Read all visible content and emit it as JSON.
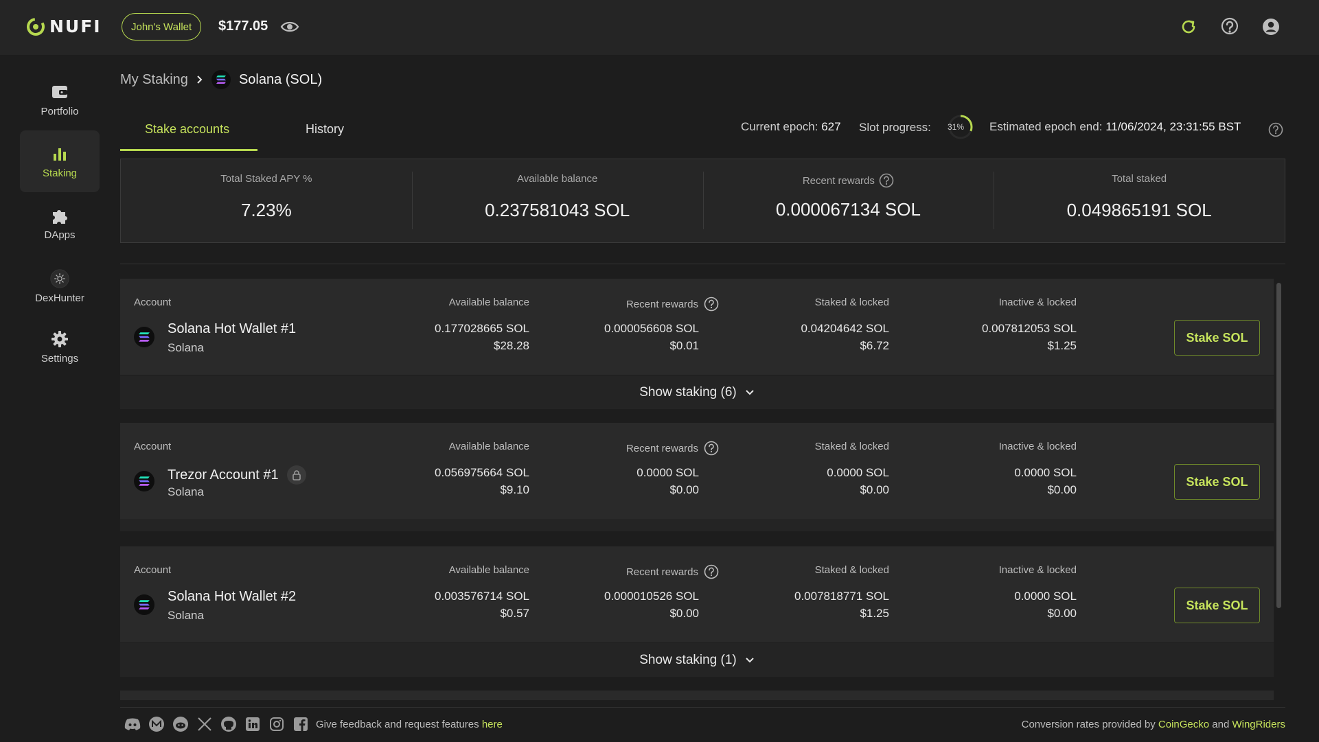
{
  "app": {
    "brand": "NUFI"
  },
  "header": {
    "wallet_name": "John's Wallet",
    "balance": "$177.05"
  },
  "sidebar": {
    "items": [
      {
        "label": "Portfolio",
        "icon": "wallet-icon"
      },
      {
        "label": "Staking",
        "icon": "bar-chart-icon",
        "active": true
      },
      {
        "label": "DApps",
        "icon": "puzzle-icon"
      },
      {
        "label": "DexHunter",
        "icon": "dexhunter-icon"
      },
      {
        "label": "Settings",
        "icon": "gear-icon"
      }
    ]
  },
  "breadcrumb": {
    "parent": "My Staking",
    "current": "Solana (SOL)"
  },
  "tabs": [
    {
      "label": "Stake accounts",
      "active": true
    },
    {
      "label": "History"
    }
  ],
  "epoch": {
    "current_label": "Current epoch:",
    "current_value": "627",
    "slot_label": "Slot progress:",
    "slot_value": "31%",
    "slot_fraction": 0.31,
    "end_label": "Estimated epoch end:",
    "end_value": "11/06/2024, 23:31:55 BST"
  },
  "summary": [
    {
      "label": "Total Staked APY %",
      "value": "7.23%"
    },
    {
      "label": "Available balance",
      "value": "0.237581043 SOL"
    },
    {
      "label": "Recent rewards",
      "value": "0.000067134 SOL"
    },
    {
      "label": "Total staked",
      "value": "0.049865191 SOL"
    }
  ],
  "columns": {
    "account": "Account",
    "available": "Available balance",
    "rewards": "Recent rewards",
    "staked": "Staked & locked",
    "inactive": "Inactive & locked"
  },
  "accounts": [
    {
      "name": "Solana Hot Wallet #1",
      "chain": "Solana",
      "available": "0.177028665 SOL",
      "available_usd": "$28.28",
      "rewards": "0.000056608 SOL",
      "rewards_usd": "$0.01",
      "staked": "0.04204642 SOL",
      "staked_usd": "$6.72",
      "inactive": "0.007812053 SOL",
      "inactive_usd": "$1.25",
      "button": "Stake SOL",
      "show_staking": "Show staking (6)"
    },
    {
      "name": "Trezor Account #1",
      "chain": "Solana",
      "available": "0.056975664 SOL",
      "available_usd": "$9.10",
      "rewards": "0.0000 SOL",
      "rewards_usd": "$0.00",
      "staked": "0.0000 SOL",
      "staked_usd": "$0.00",
      "inactive": "0.0000 SOL",
      "inactive_usd": "$0.00",
      "button": "Stake SOL"
    },
    {
      "name": "Solana Hot Wallet #2",
      "chain": "Solana",
      "available": "0.003576714 SOL",
      "available_usd": "$0.57",
      "rewards": "0.000010526 SOL",
      "rewards_usd": "$0.00",
      "staked": "0.007818771 SOL",
      "staked_usd": "$1.25",
      "inactive": "0.0000 SOL",
      "inactive_usd": "$0.00",
      "button": "Stake SOL",
      "show_staking": "Show staking (1)"
    }
  ],
  "footer": {
    "feedback": "Give feedback and request features",
    "feedback_link": "here",
    "rates_prefix": "Conversion rates provided by",
    "rates_source_1": "CoinGecko",
    "rates_and": "and",
    "rates_source_2": "WingRiders",
    "social_icons": [
      "discord-icon",
      "medium-icon",
      "reddit-icon",
      "x-icon",
      "github-icon",
      "linkedin-icon",
      "instagram-icon",
      "facebook-icon"
    ]
  },
  "colors": {
    "accent": "#b6d84f",
    "background": "#1d1d1d",
    "card": "#2a2a2a"
  }
}
